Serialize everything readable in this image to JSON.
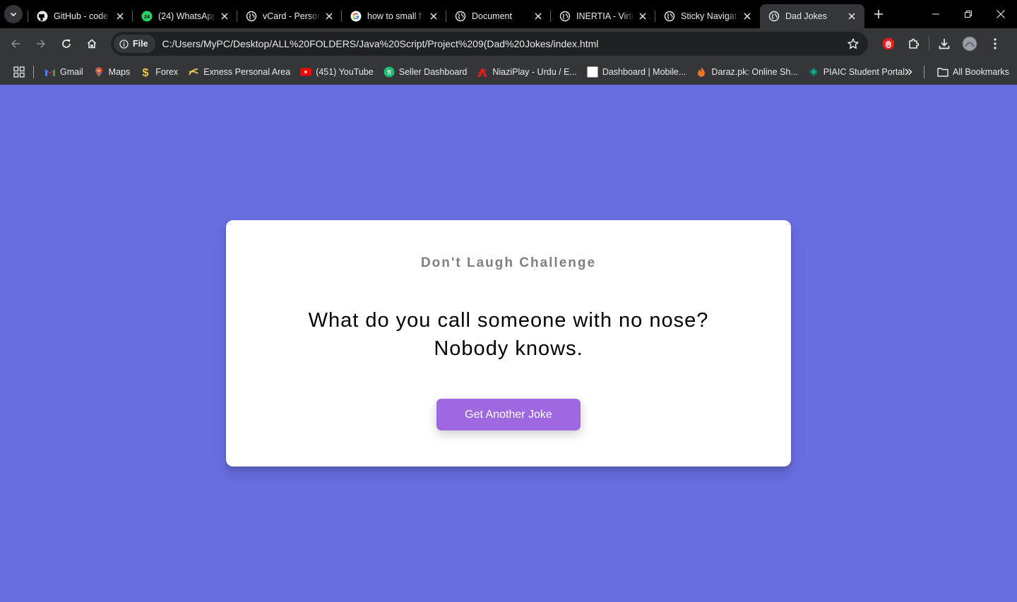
{
  "browser": {
    "tabs": [
      {
        "title": "GitHub - code",
        "favicon": "github-icon",
        "active": false
      },
      {
        "title": "(24) WhatsApp",
        "favicon": "whatsapp-icon",
        "badge": "24",
        "active": false
      },
      {
        "title": "vCard - Person",
        "favicon": "globe-icon",
        "active": false
      },
      {
        "title": "how to small f",
        "favicon": "google-icon",
        "active": false
      },
      {
        "title": "Document",
        "favicon": "globe-icon",
        "active": false
      },
      {
        "title": "INERTIA - Virtu",
        "favicon": "globe-icon",
        "active": false
      },
      {
        "title": "Sticky Navigat",
        "favicon": "globe-icon",
        "active": false
      },
      {
        "title": "Dad Jokes",
        "favicon": "globe-icon",
        "active": true
      }
    ],
    "address": {
      "chip": "File",
      "url": "C:/Users/MyPC/Desktop/ALL%20FOLDERS/Java%20Script/Project%209(Dad%20Jokes/index.html"
    },
    "bookmarks": [
      {
        "label": "Gmail",
        "icon": "gmail-icon"
      },
      {
        "label": "Maps",
        "icon": "maps-icon"
      },
      {
        "label": "Forex",
        "icon": "dollar-icon"
      },
      {
        "label": "Exness Personal Area",
        "icon": "exness-icon"
      },
      {
        "label": "(451) YouTube",
        "icon": "youtube-icon"
      },
      {
        "label": "Seller Dashboard",
        "icon": "fiverr-icon"
      },
      {
        "label": "NiaziPlay - Urdu / E...",
        "icon": "niaziplay-icon"
      },
      {
        "label": "Dashboard | Mobile...",
        "icon": "blank-page-icon"
      },
      {
        "label": "Daraz.pk: Online Sh...",
        "icon": "daraz-icon"
      },
      {
        "label": "PIAIC Student Portal",
        "icon": "piaic-icon"
      }
    ],
    "all_bookmarks": "All Bookmarks"
  },
  "page": {
    "background": "#686de0",
    "accent": "#9f68e0",
    "heading": "Don't Laugh Challenge",
    "joke_line1": "What do you call someone with no nose?",
    "joke_line2": "Nobody knows.",
    "button_label": "Get Another Joke"
  }
}
